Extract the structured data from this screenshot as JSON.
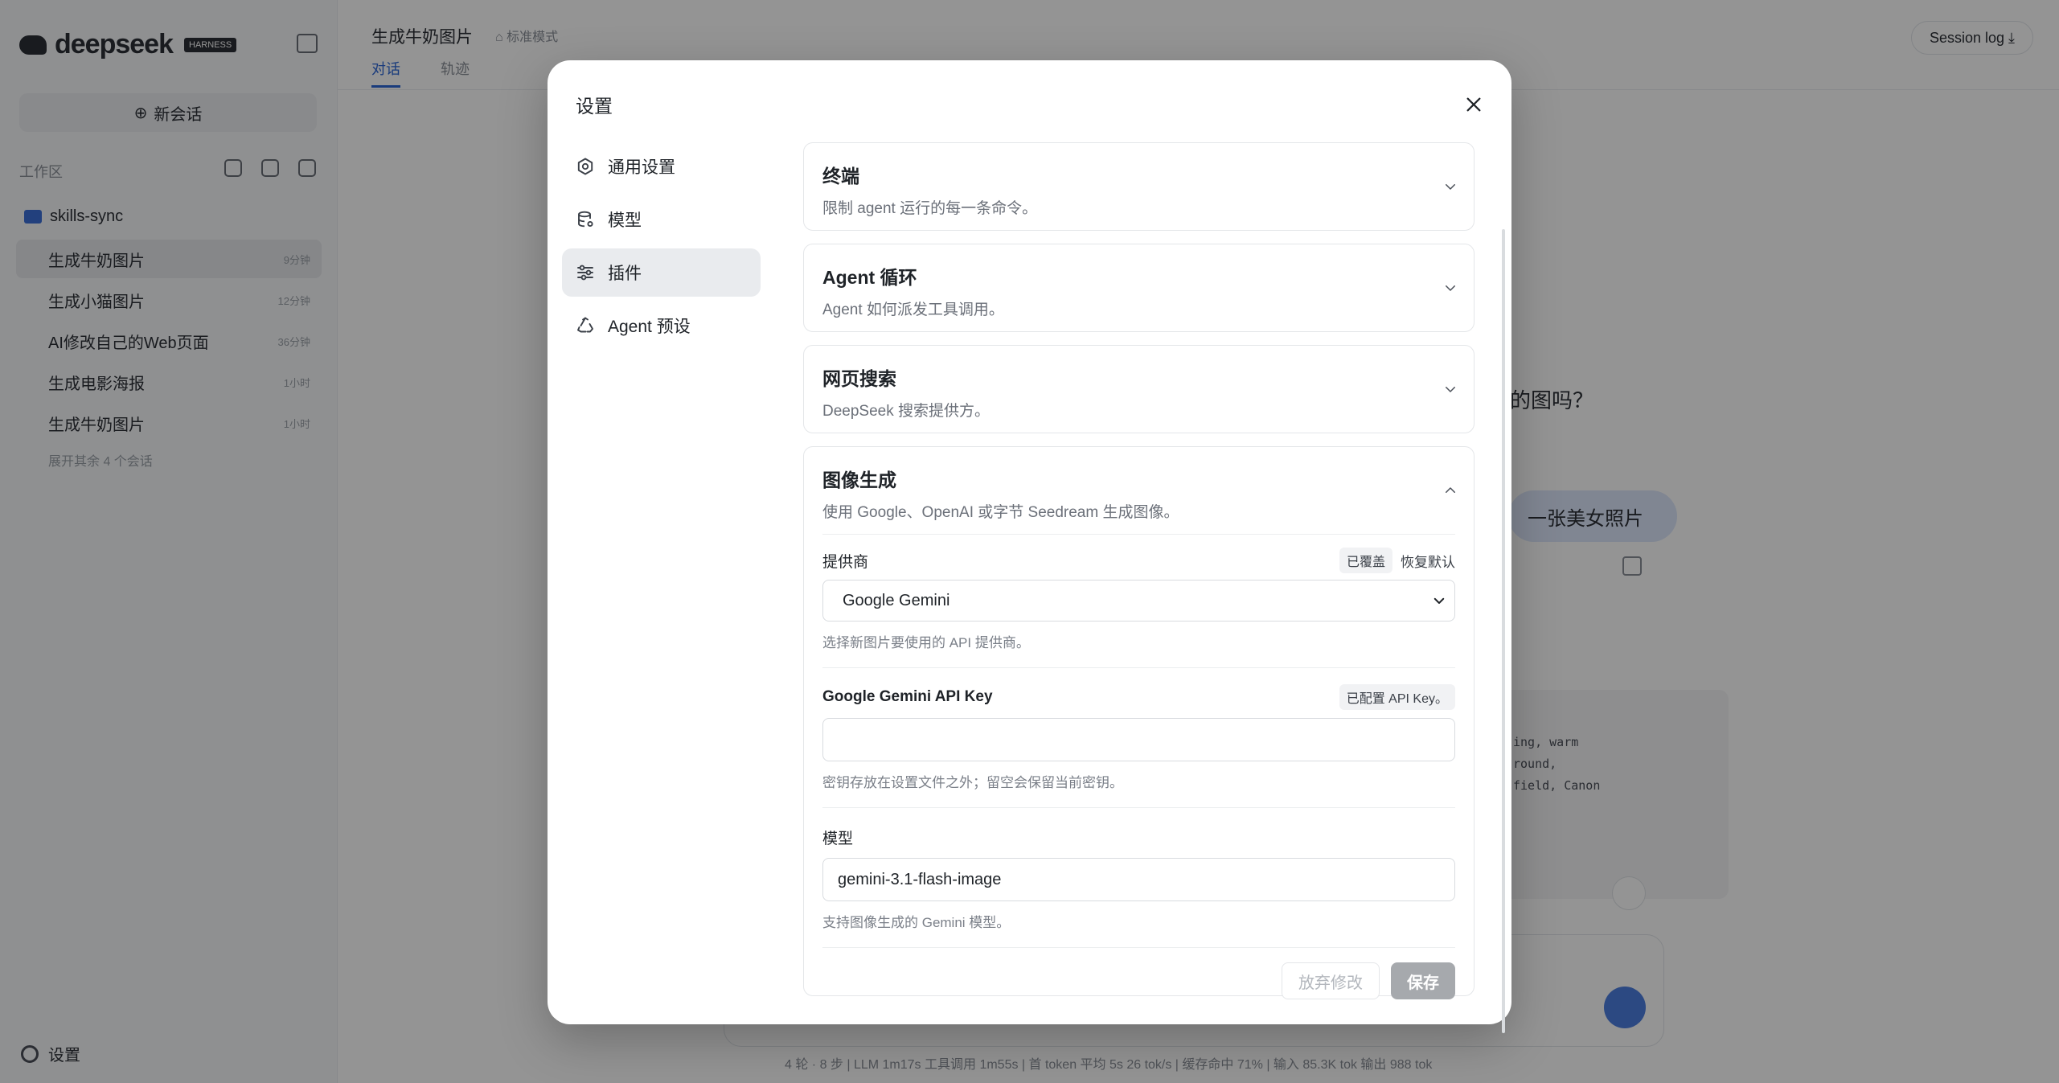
{
  "background": {
    "logo_text": "deepseek",
    "logo_badge": "HARNESS",
    "new_chat_label": "新会话",
    "workspace_label": "工作区",
    "folder_name": "skills-sync",
    "sessions": [
      {
        "title": "生成牛奶图片",
        "time": "9分钟"
      },
      {
        "title": "生成小猫图片",
        "time": "12分钟"
      },
      {
        "title": "AI修改自己的Web页面",
        "time": "36分钟"
      },
      {
        "title": "生成电影海报",
        "time": "1小时"
      },
      {
        "title": "生成牛奶图片",
        "time": "1小时"
      }
    ],
    "more_sessions": "展开其余 4 个会话",
    "footer_settings": "设置",
    "chat_title": "生成牛奶图片",
    "mode_label": "标准模式",
    "tabs": [
      "对话",
      "轨迹"
    ],
    "session_log": "Session log",
    "question_fragment": "的图吗？",
    "user_bubble": "一张美女照片",
    "code_lines": [
      "ing, warm",
      "round,",
      "field, Canon"
    ],
    "statusbar": "4 轮  ·  8 步  |  LLM 1m17s  工具调用 1m55s  |  首 token 平均 5s  26 tok/s  |  缓存命中 71%  |  输入 85.3K tok  输出 988 tok"
  },
  "modal": {
    "title": "设置",
    "nav": [
      {
        "label": "通用设置",
        "icon": "gear-icon"
      },
      {
        "label": "模型",
        "icon": "database-icon"
      },
      {
        "label": "插件",
        "icon": "sliders-icon"
      },
      {
        "label": "Agent 预设",
        "icon": "recycle-icon"
      }
    ],
    "active_nav": "插件",
    "sections": [
      {
        "title": "终端",
        "desc": "限制 agent 运行的每一条命令。"
      },
      {
        "title": "Agent 循环",
        "desc": "Agent 如何派发工具调用。"
      },
      {
        "title": "网页搜索",
        "desc": "DeepSeek 搜索提供方。"
      }
    ],
    "image_gen": {
      "title": "图像生成",
      "desc": "使用 Google、OpenAI 或字节 Seedream 生成图像。",
      "provider": {
        "label": "提供商",
        "tag_overridden": "已覆盖",
        "reset_label": "恢复默认",
        "value": "Google Gemini",
        "hint": "选择新图片要使用的 API 提供商。"
      },
      "api_key": {
        "label": "Google Gemini API Key",
        "tag_configured": "已配置 API Key。",
        "value": "",
        "hint": "密钥存放在设置文件之外；留空会保留当前密钥。"
      },
      "model": {
        "label": "模型",
        "value": "gemini-3.1-flash-image",
        "hint": "支持图像生成的 Gemini 模型。"
      },
      "discard_label": "放弃修改",
      "save_label": "保存"
    }
  }
}
